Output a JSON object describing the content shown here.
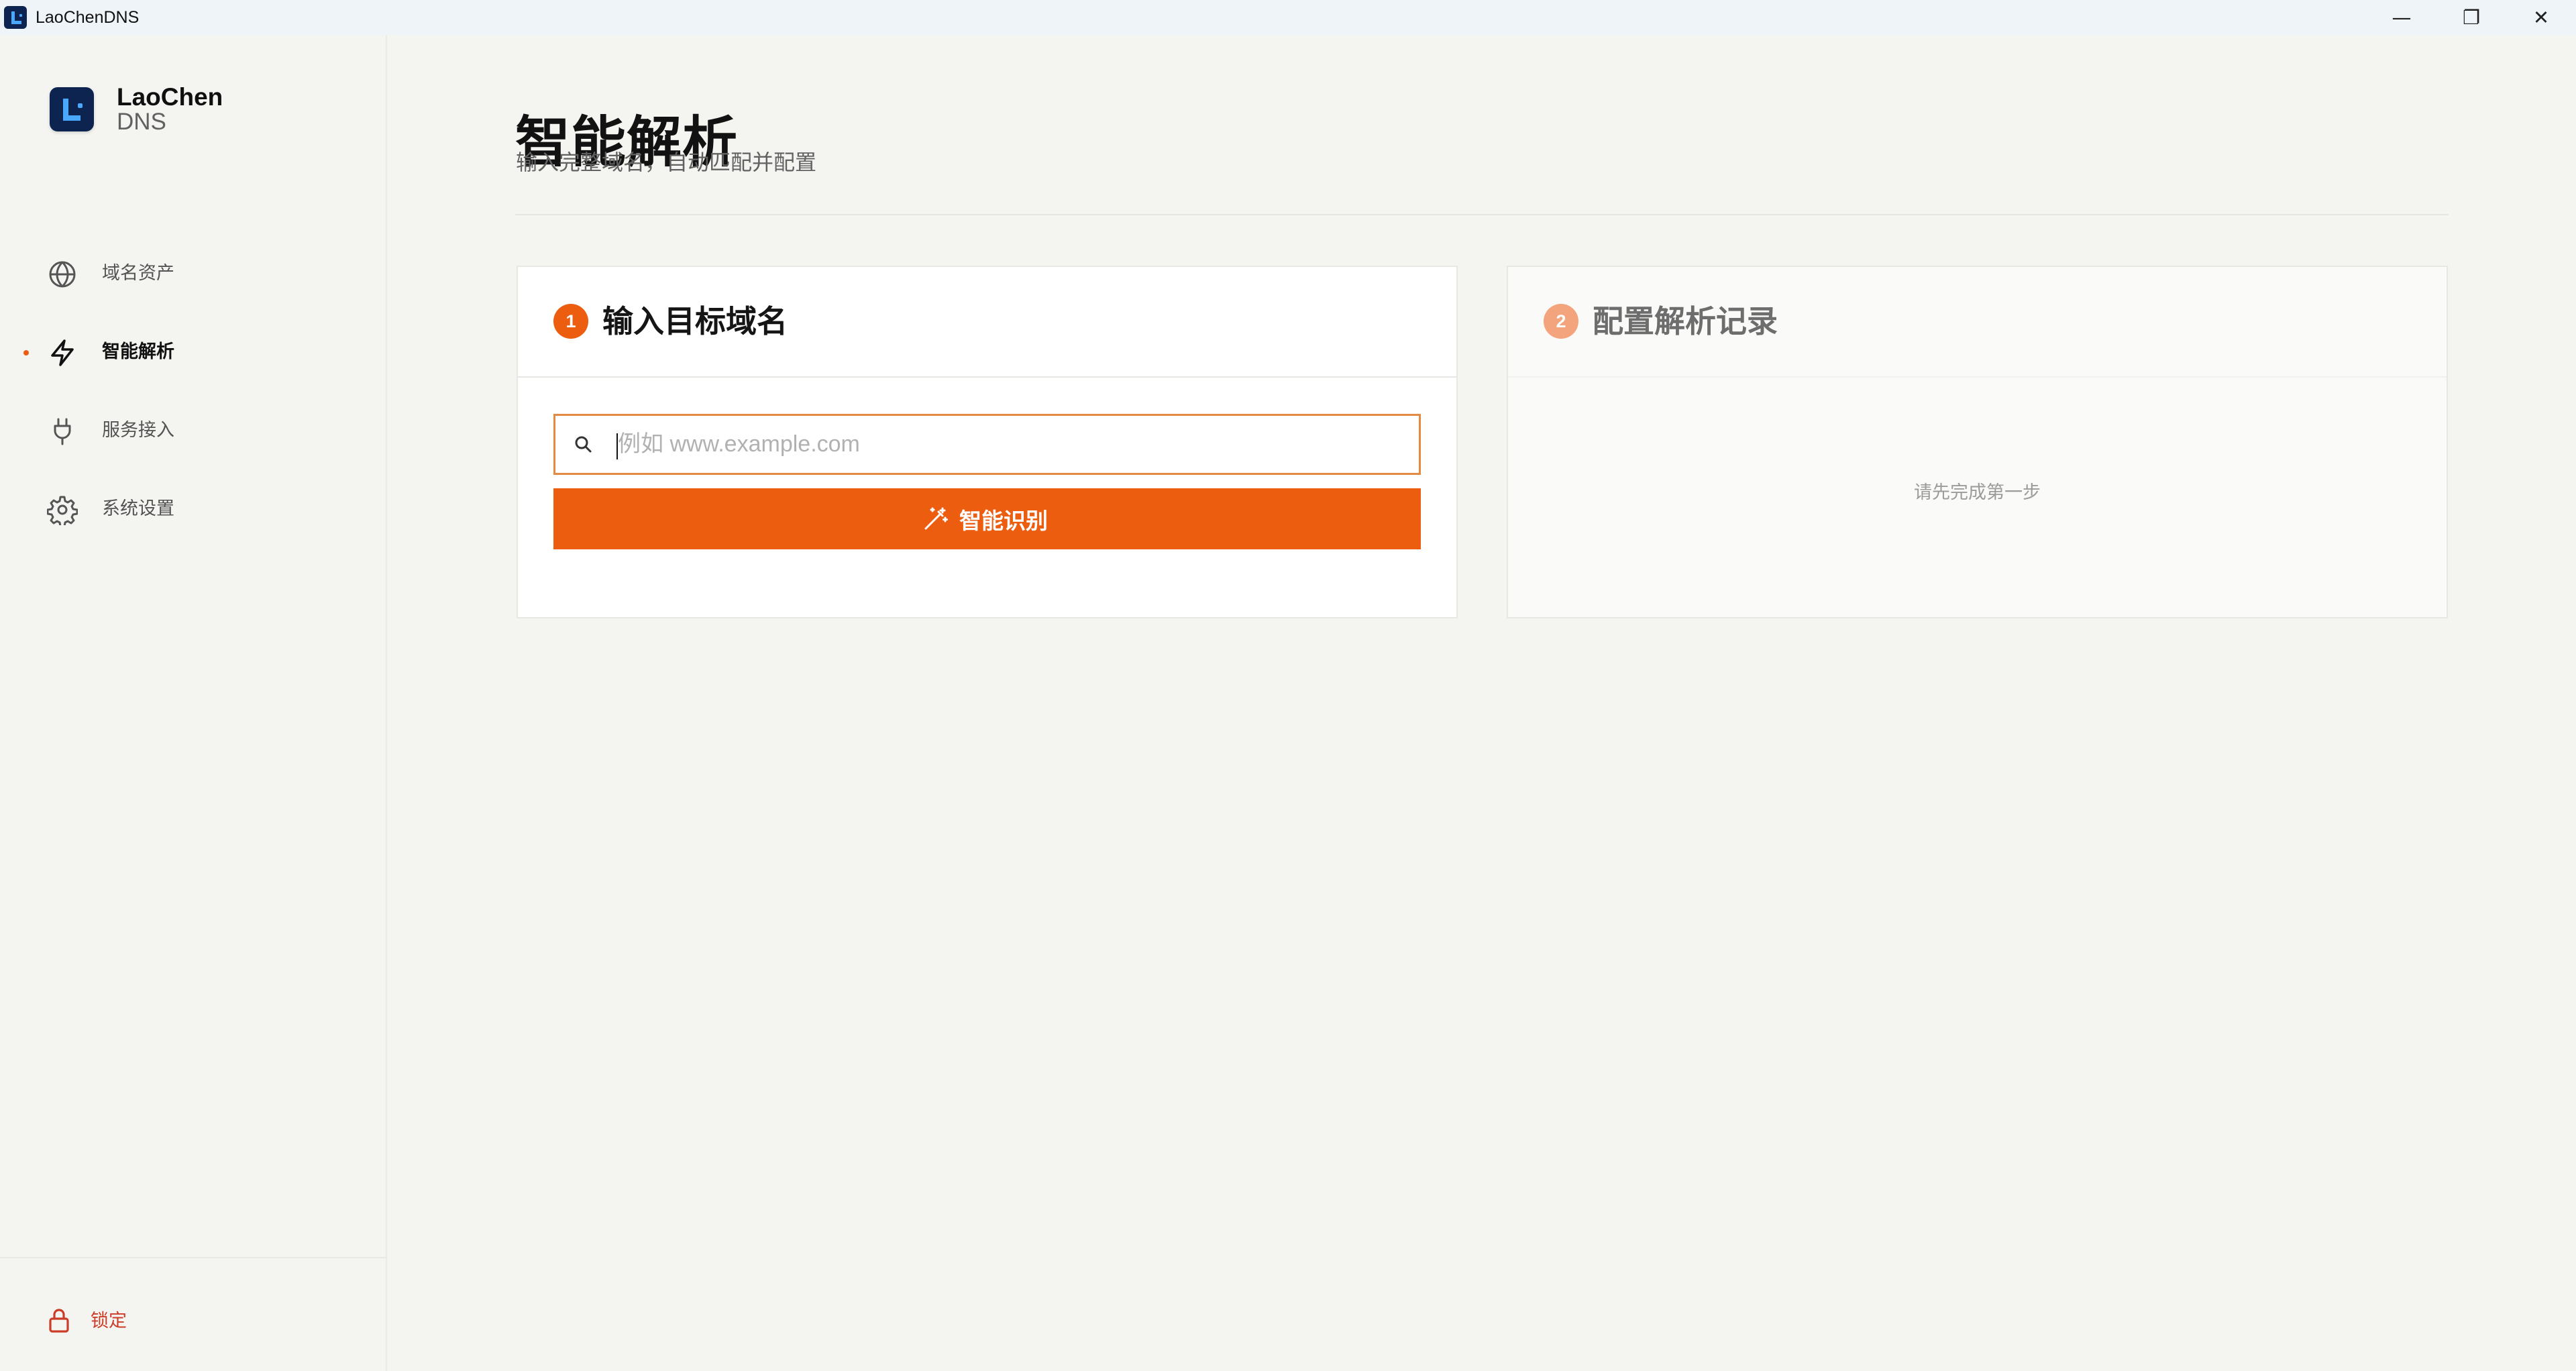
{
  "window": {
    "title": "LaoChenDNS",
    "controls": {
      "minimize": "—",
      "restore": "❐",
      "close": "✕"
    }
  },
  "brand": {
    "name": "LaoChen",
    "sub": "DNS",
    "icon": "laochen-logo-icon"
  },
  "sidebar": {
    "items": [
      {
        "label": "域名资产",
        "icon": "globe-icon",
        "active": false
      },
      {
        "label": "智能解析",
        "icon": "lightning-icon",
        "active": true
      },
      {
        "label": "服务接入",
        "icon": "plug-icon",
        "active": false
      },
      {
        "label": "系统设置",
        "icon": "gear-icon",
        "active": false
      }
    ],
    "footer": {
      "lock_label": "锁定",
      "icon": "lock-icon"
    }
  },
  "page": {
    "title": "智能解析",
    "subtitle": "输入完整域名，自动匹配并配置"
  },
  "steps": [
    {
      "number": "1",
      "title": "输入目标域名",
      "search": {
        "value": "",
        "placeholder": "例如 www.example.com",
        "icon": "search-icon"
      },
      "button": {
        "label": "智能识别",
        "icon": "magic-wand-icon"
      }
    },
    {
      "number": "2",
      "title": "配置解析记录",
      "empty_text": "请先完成第一步"
    }
  ],
  "colors": {
    "accent": "#ed5d10",
    "accent_disabled": "#f3a47c",
    "danger": "#cc3c27",
    "brand_dark": "#0d2450",
    "brand_blue": "#4aa8ff",
    "background": "#f4f4f1"
  }
}
